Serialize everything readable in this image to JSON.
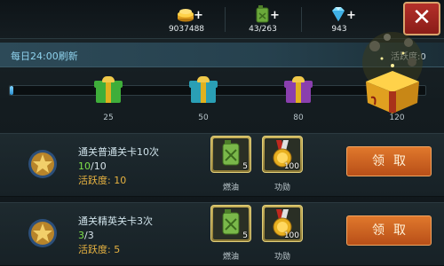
{
  "resources": {
    "gold": {
      "value": "9037488",
      "icon": "gold-coins-icon"
    },
    "fuel": {
      "value": "43/263",
      "icon": "fuel-can-icon"
    },
    "diamond": {
      "value": "943",
      "icon": "diamond-icon"
    },
    "plus": "+"
  },
  "close_label": "✕",
  "refresh_text": "每日24:00刷新",
  "activity_label": "活跃度:0",
  "milestones": {
    "progress_fraction": 0.0,
    "items": [
      {
        "label": "25",
        "color": "#3fae3a"
      },
      {
        "label": "50",
        "color": "#2a9fb5"
      },
      {
        "label": "80",
        "color": "#8a3fae"
      },
      {
        "label": "120",
        "color": "#e0b11f"
      }
    ]
  },
  "tasks": [
    {
      "name": "通关普通关卡10次",
      "progress_current": "10",
      "progress_total": "/10",
      "activity": "活跃度: 10",
      "rewards": [
        {
          "qty": "5",
          "label": "燃油",
          "icon": "fuel-can-icon"
        },
        {
          "qty": "100",
          "label": "功勋",
          "icon": "medal-icon"
        }
      ],
      "claim_label": "领取"
    },
    {
      "name": "通关精英关卡3次",
      "progress_current": "3",
      "progress_total": "/3",
      "activity": "活跃度: 5",
      "rewards": [
        {
          "qty": "5",
          "label": "燃油",
          "icon": "fuel-can-icon"
        },
        {
          "qty": "100",
          "label": "功勋",
          "icon": "medal-icon"
        }
      ],
      "claim_label": "领取"
    }
  ]
}
